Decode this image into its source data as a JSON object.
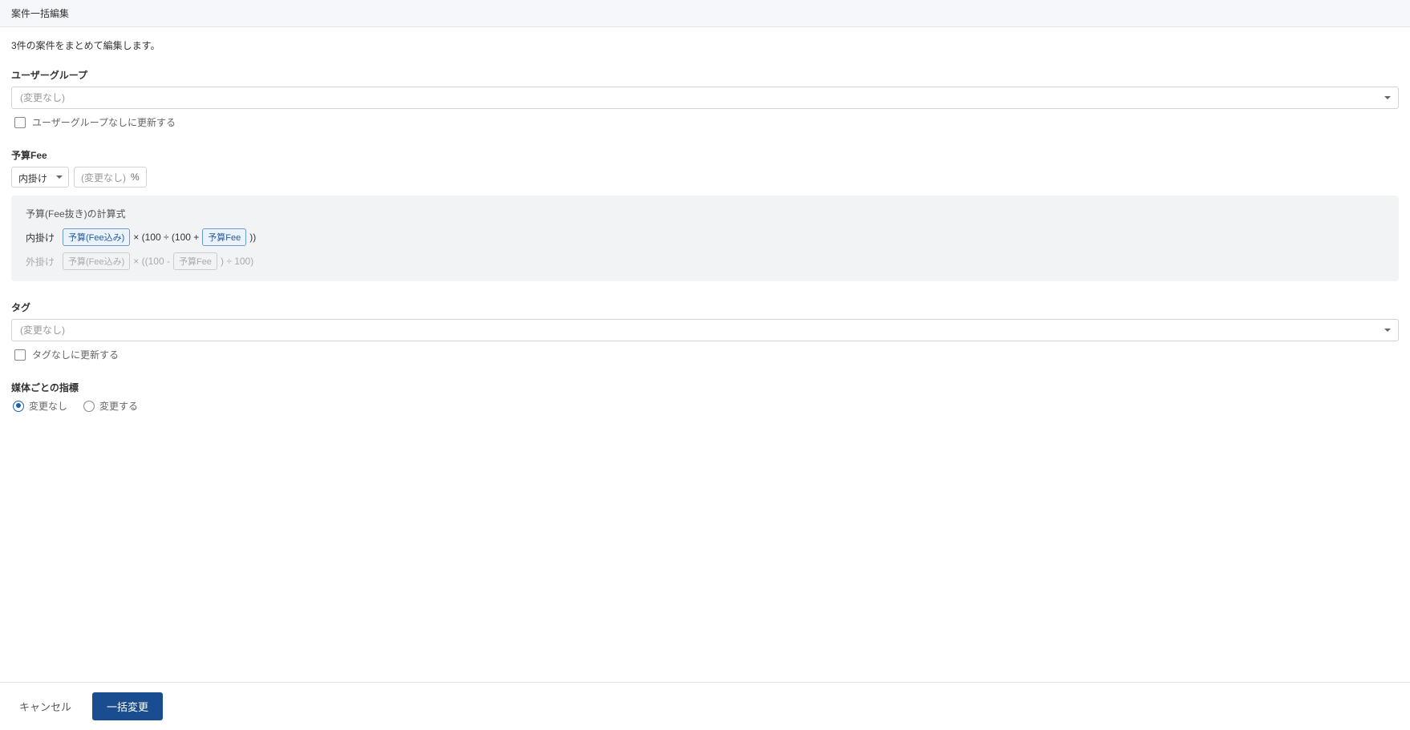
{
  "header": {
    "title": "案件一括編集"
  },
  "subtitle": "3件の案件をまとめて編集します。",
  "userGroup": {
    "label": "ユーザーグループ",
    "placeholder": "(変更なし)",
    "checkboxLabel": "ユーザーグループなしに更新する"
  },
  "budgetFee": {
    "label": "予算Fee",
    "typeSelect": "内掛け",
    "percentPlaceholder": "(変更なし)",
    "percentSign": "%",
    "formula": {
      "title": "予算(Fee抜き)の計算式",
      "lines": [
        {
          "label": "内掛け",
          "chip1": "予算(Fee込み)",
          "text1": " × (100 ÷ (100 + ",
          "chip2": "予算Fee",
          "text2": " ))",
          "muted": false
        },
        {
          "label": "外掛け",
          "chip1": "予算(Fee込み)",
          "text1": " × ((100 - ",
          "chip2": "予算Fee",
          "text2": " ) ÷ 100)",
          "muted": true
        }
      ]
    }
  },
  "tag": {
    "label": "タグ",
    "placeholder": "(変更なし)",
    "checkboxLabel": "タグなしに更新する"
  },
  "mediaMetrics": {
    "label": "媒体ごとの指標",
    "options": [
      {
        "label": "変更なし",
        "checked": true
      },
      {
        "label": "変更する",
        "checked": false
      }
    ]
  },
  "footer": {
    "cancel": "キャンセル",
    "submit": "一括変更"
  }
}
